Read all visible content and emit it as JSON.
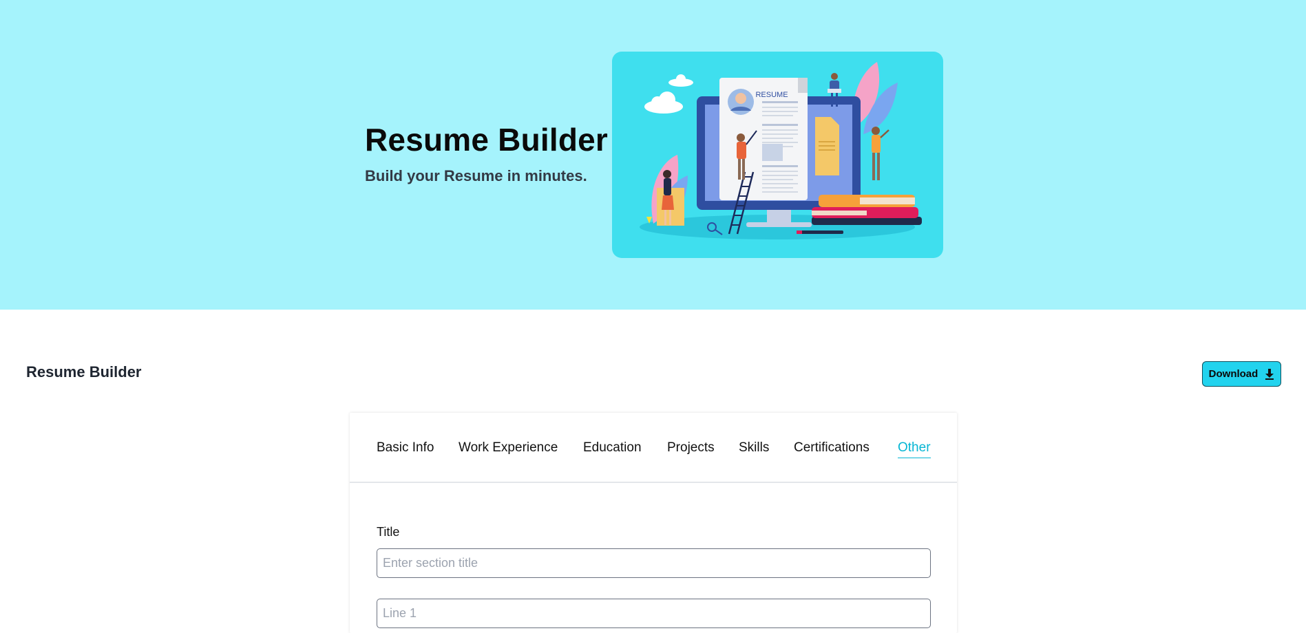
{
  "hero": {
    "title": "Resume Builder",
    "subtitle": "Build your Resume in minutes.",
    "illustration_label": "RESUME",
    "background_color": "#a5f3fc",
    "art_background_color": "#3fdfee"
  },
  "toolbar": {
    "title": "Resume Builder",
    "download_label": "Download",
    "download_icon": "download-icon",
    "accent_color": "#22d3ee"
  },
  "tabs": [
    {
      "label": "Basic Info",
      "active": false
    },
    {
      "label": "Work Experience",
      "active": false
    },
    {
      "label": "Education",
      "active": false
    },
    {
      "label": "Projects",
      "active": false
    },
    {
      "label": "Skills",
      "active": false
    },
    {
      "label": "Certifications",
      "active": false
    },
    {
      "label": "Other",
      "active": true
    }
  ],
  "form": {
    "title_label": "Title",
    "title_value": "",
    "title_placeholder": "Enter section title",
    "line1_value": "",
    "line1_placeholder": "Line 1"
  }
}
